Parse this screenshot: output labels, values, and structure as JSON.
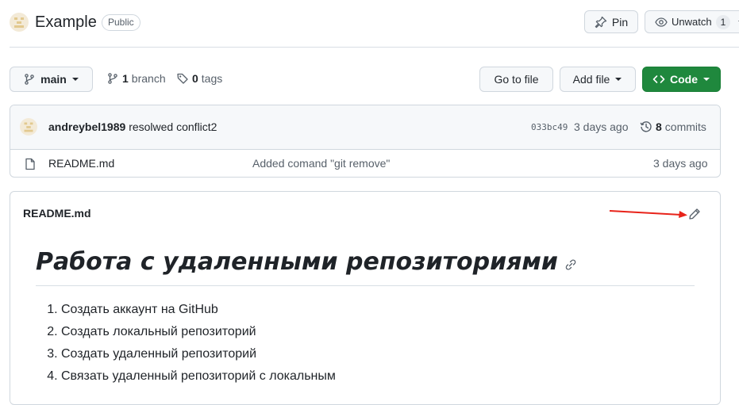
{
  "repo": {
    "name": "Example",
    "visibility": "Public"
  },
  "header_actions": {
    "pin_label": "Pin",
    "unwatch_label": "Unwatch",
    "watch_count": "1"
  },
  "toolbar": {
    "branch_label": "main",
    "branches_count": "1",
    "branches_label": "branch",
    "tags_count": "0",
    "tags_label": "tags",
    "go_to_file_label": "Go to file",
    "add_file_label": "Add file",
    "code_label": "Code"
  },
  "latest_commit": {
    "author": "andreybel1989",
    "message": "resolwed conflict2",
    "hash": "033bc49",
    "time": "3 days ago",
    "commits_count": "8",
    "commits_label": "commits"
  },
  "files": [
    {
      "name": "README.md",
      "message": "Added comand \"git remove\"",
      "time": "3 days ago"
    }
  ],
  "readme": {
    "filename": "README.md",
    "heading": "Работа с удаленными репозиториями",
    "items": [
      "Создать аккаунт на GitHub",
      "Создать локальный репозиторий",
      "Создать удаленный репозиторий",
      "Связать удаленный репозиторий с локальным"
    ]
  },
  "colors": {
    "accent_green": "#1f883d",
    "annotation_arrow": "#e8231a",
    "border": "#d0d7de"
  },
  "icons": [
    "avatar-icon",
    "pin-icon",
    "eye-icon",
    "caret-down-icon",
    "branch-icon",
    "tag-icon",
    "code-icon",
    "history-icon",
    "file-icon",
    "pencil-icon",
    "link-icon"
  ]
}
